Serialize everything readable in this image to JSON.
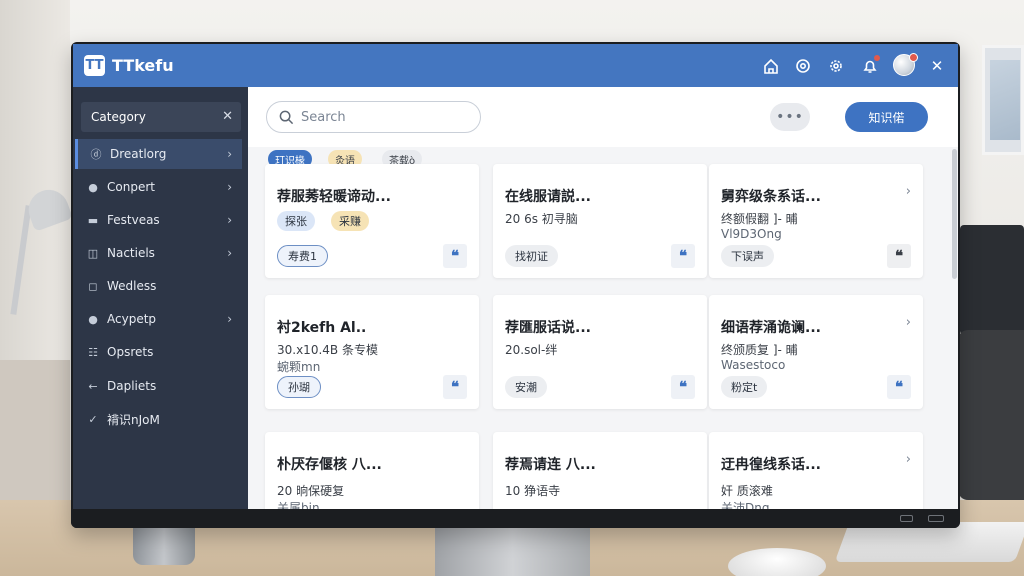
{
  "app": {
    "title": "TTkefu",
    "logo_text": "TT"
  },
  "titlebar": {
    "icons": [
      "home-icon",
      "settings-icon",
      "gear-icon",
      "bell-icon",
      "avatar",
      "close-icon"
    ],
    "close_glyph": "✕"
  },
  "sidebar": {
    "category_label": "Category",
    "close_glyph": "✕",
    "items": [
      {
        "label": "Dreatlorg",
        "icon": "ⓓ",
        "chevron": "›"
      },
      {
        "label": "Conpert",
        "icon": "●",
        "chevron": "›"
      },
      {
        "label": "Festveas",
        "icon": "▬",
        "chevron": "›"
      },
      {
        "label": "Nactiels",
        "icon": "◫",
        "chevron": "›"
      },
      {
        "label": "Wedless",
        "icon": "◻",
        "chevron": ""
      },
      {
        "label": "Acypetp",
        "icon": "●",
        "chevron": "›"
      },
      {
        "label": "Opsrets",
        "icon": "☷",
        "chevron": ""
      },
      {
        "label": "Dapliets",
        "icon": "←",
        "chevron": ""
      },
      {
        "label": "褙识nJoM",
        "icon": "✓",
        "chevron": ""
      }
    ]
  },
  "toolbar": {
    "search_placeholder": "Search",
    "more_label": "•••",
    "primary_button": "知识偌"
  },
  "filters": [
    {
      "label": "玎识椽"
    },
    {
      "label": "灸语"
    },
    {
      "label": "茶载ò"
    }
  ],
  "cards": [
    {
      "title": "荐服莠轻暖谛动...",
      "line1": "",
      "line2": "",
      "tags": [
        "探张",
        "采赚"
      ],
      "pill": "寿费1",
      "chevron": ""
    },
    {
      "title": "在线服请説...",
      "line1": "20 6s 初寻脑",
      "line2": "",
      "tags": [],
      "pill": "找初证",
      "chevron": ""
    },
    {
      "title": "舅弈级条系话...",
      "line1": "终额假翻 ]- 晡",
      "line2": "Vl9D3Ong",
      "tags": [],
      "pill": "下误声",
      "chevron": "›"
    },
    {
      "title": "衬2kefh Al..",
      "line1": "30.x10.4B 条专模",
      "line2": "蜿颗mn",
      "tags": [],
      "pill": "孙瑚",
      "chevron": ""
    },
    {
      "title": "荐匯服话说...",
      "line1": "20.sol-绊",
      "line2": "",
      "tags": [],
      "pill": "安潮",
      "chevron": ""
    },
    {
      "title": "细语荐涌诡谰...",
      "line1": "终颁质复 ]- 晡",
      "line2": "Wasestoco",
      "tags": [],
      "pill": "粉定t",
      "chevron": "›"
    },
    {
      "title": "朴厌存偃核 八...",
      "line1": "20 晌保硬复",
      "line2": "关属bin",
      "tags": [],
      "pill": "",
      "chevron": ""
    },
    {
      "title": "荐焉请连 八...",
      "line1": "10 狰语寺",
      "line2": "",
      "tags": [],
      "pill": "",
      "chevron": ""
    },
    {
      "title": "迂冉徨线系话...",
      "line1": "奸 质滚难",
      "line2": "关沛Dng",
      "tags": [],
      "pill": "",
      "chevron": "›"
    }
  ],
  "quote_glyph": "❝",
  "colors": {
    "titlebar": "#4476c0",
    "sidebar": "#2d3647",
    "accent": "#3e73c2",
    "tag_blue": "#dbe6f7",
    "tag_yellow": "#f6e3b5"
  }
}
